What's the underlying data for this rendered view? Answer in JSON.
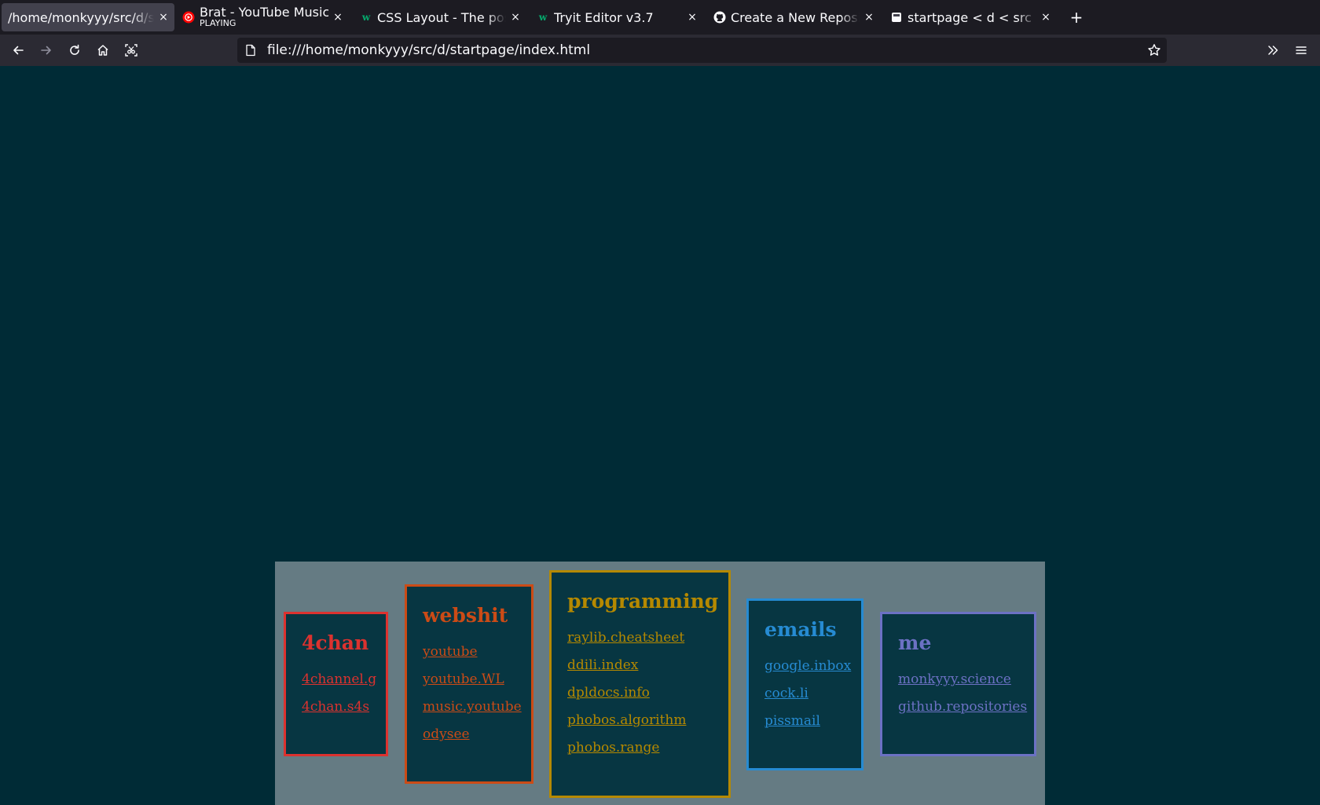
{
  "tabs": [
    {
      "title": "/home/monkyyy/src/d/startpage/index.html",
      "subtitle": "",
      "favicon": "none",
      "active": true
    },
    {
      "title": "Brat - YouTube Music",
      "subtitle": "PLAYING",
      "favicon": "youtube-music-icon",
      "active": false
    },
    {
      "title": "CSS Layout - The position Property",
      "subtitle": "",
      "favicon": "w3schools-icon",
      "active": false
    },
    {
      "title": "Tryit Editor v3.7",
      "subtitle": "",
      "favicon": "w3schools-icon",
      "active": false
    },
    {
      "title": "Create a New Repository",
      "subtitle": "",
      "favicon": "github-icon",
      "active": false
    },
    {
      "title": "startpage < d < src < monkyyy",
      "subtitle": "",
      "favicon": "page-icon",
      "active": false
    }
  ],
  "close_glyph": "×",
  "new_tab_glyph": "+",
  "url": "file:///home/monkyyy/src/d/startpage/index.html",
  "cards": [
    {
      "title": "4chan",
      "color": "#dc322f",
      "links": [
        "4channel.g",
        "4chan.s4s"
      ]
    },
    {
      "title": "webshit",
      "color": "#cb4b16",
      "links": [
        "youtube",
        "youtube.WL",
        "music.youtube",
        "odysee"
      ]
    },
    {
      "title": "programming",
      "color": "#b58900",
      "links": [
        "raylib.cheatsheet",
        "ddili.index",
        "dpldocs.info",
        "phobos.algorithm",
        "phobos.range"
      ]
    },
    {
      "title": "emails",
      "color": "#268bd2",
      "links": [
        "google.inbox",
        "cock.li",
        "pissmail"
      ]
    },
    {
      "title": "me",
      "color": "#6c71c4",
      "links": [
        "monkyyy.science",
        "github.repositories"
      ]
    }
  ],
  "colors": {
    "page_bg": "#002b36",
    "panel_bg": "#657b83",
    "card_bg": "#073642",
    "tabbar_bg": "#1c1b22",
    "navbar_bg": "#2b2a33"
  }
}
